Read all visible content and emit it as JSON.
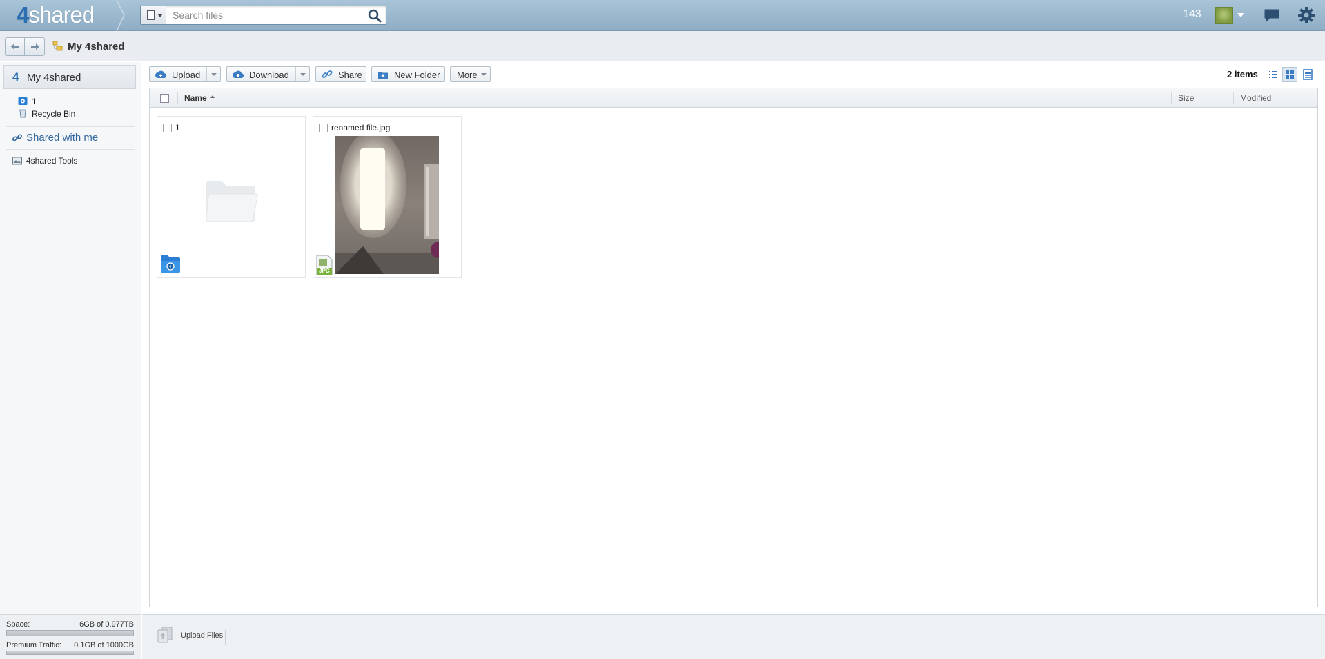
{
  "header": {
    "logo": "4shared",
    "logo_prefix": "4",
    "logo_suffix": "shared",
    "search_placeholder": "Search files",
    "counter": "143",
    "icons": [
      "file-type-icon",
      "search-icon",
      "avatar",
      "chat-icon",
      "gear-icon"
    ]
  },
  "breadcrumb": {
    "current": "My 4shared"
  },
  "sidebar": {
    "root": "My 4shared",
    "root_icon": "4",
    "tree": [
      {
        "label": "1",
        "icon": "shared-folder-icon"
      },
      {
        "label": "Recycle Bin",
        "icon": "recycle-bin-icon"
      }
    ],
    "shared_with_me": "Shared with me",
    "tools": "4shared Tools"
  },
  "storage": {
    "space_label": "Space:",
    "space_value": "6GB of 0.977TB",
    "space_fraction": 0.006,
    "traffic_label": "Premium Traffic:",
    "traffic_value": "0.1GB of 1000GB",
    "traffic_fraction": 0.0001
  },
  "toolbar": {
    "upload": "Upload",
    "download": "Download",
    "share": "Share",
    "new_folder": "New Folder",
    "more": "More"
  },
  "items_count": "2 items",
  "columns": {
    "name": "Name",
    "size": "Size",
    "modified": "Modified"
  },
  "items": [
    {
      "name": "1",
      "type": "folder"
    },
    {
      "name": "renamed file.jpg",
      "type": "jpg",
      "badge": "JPG"
    }
  ],
  "bottom": {
    "upload_files": "Upload Files"
  },
  "colors": {
    "header": "#98b5cb",
    "accent": "#2c6fb3",
    "folder": "#2a7fd4",
    "jpg_badge": "#7ab33a"
  }
}
